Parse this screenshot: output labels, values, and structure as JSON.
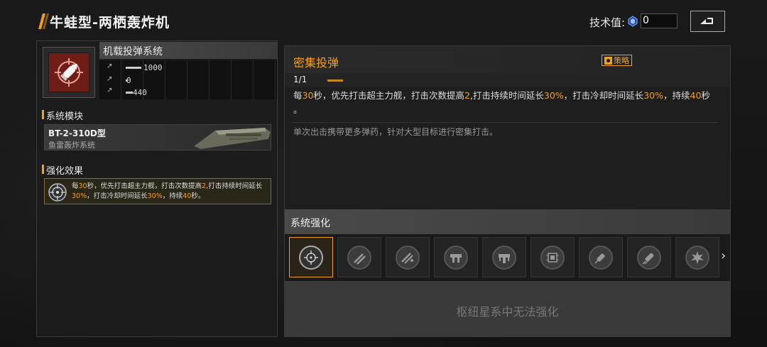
{
  "header": {
    "title": "牛蛙型-两栖轰炸机",
    "tech_label": "技术值:",
    "tech_value": "0"
  },
  "left": {
    "system_name": "机载投弹系统",
    "stats": [
      {
        "value": "1000",
        "fill": 0.8
      },
      {
        "value": "0",
        "fill": 0.0
      },
      {
        "value": "440",
        "fill": 0.35
      }
    ],
    "module_section": "系统模块",
    "module_name": "BT-2-310D型",
    "module_type": "鱼雷轰炸系统",
    "effect_section": "强化效果",
    "effect_text": {
      "p1": "每",
      "v1": "30",
      "p2": "秒，优先打击超主力舰，打击次数提高",
      "v2": "2",
      "p3": ",打击持续时间延长",
      "v3": "30%",
      "p4": "，打击冷却时间延长",
      "v4": "30%",
      "p5": "，持续",
      "v5": "40",
      "p6": "秒。"
    }
  },
  "right": {
    "skill_title": "密集投弹",
    "strategy_label": "策略",
    "level": "1/1",
    "desc": {
      "p1": "每",
      "v1": "30",
      "p2": "秒，优先打击超主力舰，打击次数提高",
      "v2": "2",
      "p3": ",打击持续时间延长",
      "v3": "30%",
      "p4": "，打击冷却时间延长",
      "v4": "30%",
      "p5": "，持续",
      "v5": "40",
      "p6": "秒",
      "p7": "。"
    },
    "flavor": "单次出击携带更多弹药，针对大型目标进行密集打击。",
    "enhance_title": "系统强化",
    "enhance_msg": "枢纽星系中无法强化"
  },
  "colors": {
    "accent": "#f0a020",
    "weapon_bg": "#6e1d17"
  }
}
